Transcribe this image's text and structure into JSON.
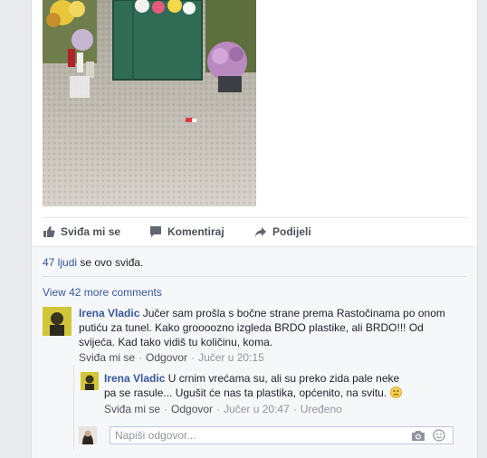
{
  "post": {
    "photo_alt": "memorial flowers and candles",
    "actions": {
      "like_label": "Sviđa mi se",
      "comment_label": "Komentiraj",
      "share_label": "Podijeli"
    }
  },
  "likes": {
    "count_link": "47 ljudi",
    "suffix": " se ovo sviđa."
  },
  "comments": {
    "view_more": "View 42 more comments",
    "items": [
      {
        "author": "Irena Vladic",
        "text": "Jučer sam prošla s bočne strane prema Rastočinama po onom putiću za tunel. Kako groooozno izgleda BRDO plastike, ali BRDO!!! Od svijeća. Kad tako vidiš tu količinu, koma.",
        "like": "Sviđa mi se",
        "reply": "Odgovor",
        "time": "Jučer u 20:15"
      }
    ],
    "replies": [
      {
        "author": "Irena Vladic",
        "text": "U crnim vrećama su, ali su preko zida pale neke pa se rasule... Ugušit će nas ta plastika, općenito, na svitu.",
        "like": "Sviđa mi se",
        "reply": "Odgovor",
        "time": "Jučer u 20:47",
        "edited": "Uređeno"
      }
    ],
    "reply_box": {
      "placeholder": "Napiši odgovor..."
    }
  },
  "colors": {
    "link": "#365899",
    "background": "#e9ebee",
    "comments_bg": "#f6f7f9"
  }
}
